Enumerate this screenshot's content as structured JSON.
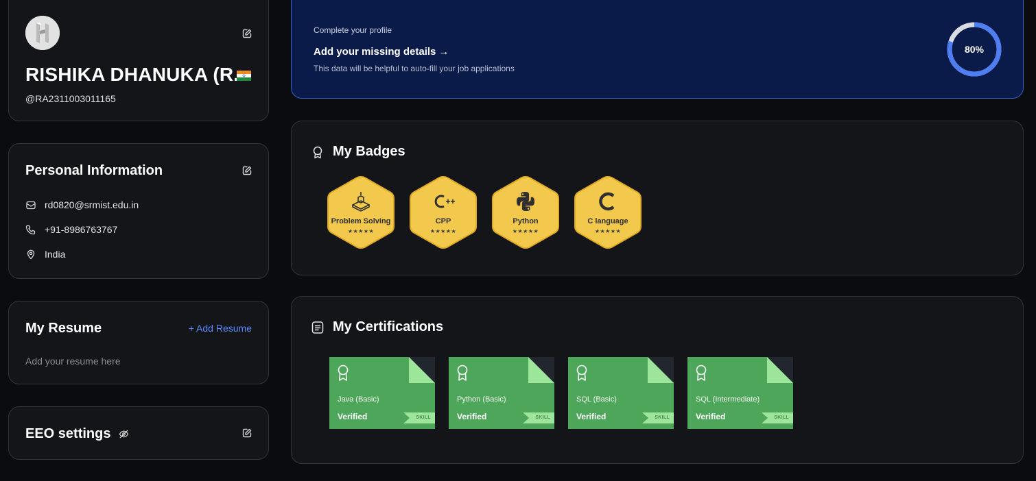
{
  "profile": {
    "name": "RISHIKA DHANUKA (R...",
    "handle": "@RA2311003011165",
    "country_flag": "india-flag-icon",
    "avatar_initial": "H"
  },
  "personal_info": {
    "title": "Personal Information",
    "email": "rd0820@srmist.edu.in",
    "phone": "+91-8986763767",
    "location": "India"
  },
  "resume": {
    "title": "My Resume",
    "add_label": "+ Add Resume",
    "hint": "Add your resume here"
  },
  "eeo": {
    "title": "EEO settings"
  },
  "banner": {
    "kicker": "Complete your profile",
    "title": "Add your missing details →",
    "description": "This data will be helpful to auto-fill your job applications",
    "progress_label": "80%",
    "progress_value": 0.8
  },
  "badges": {
    "title": "My Badges",
    "items": [
      {
        "name": "Problem Solving",
        "stars": "★★★★★",
        "icon": "problem-solving-icon"
      },
      {
        "name": "CPP",
        "stars": "★★★★★",
        "icon": "cpp-icon"
      },
      {
        "name": "Python",
        "stars": "★★★★★",
        "icon": "python-icon"
      },
      {
        "name": "C language",
        "stars": "★★★★★",
        "icon": "c-language-icon"
      }
    ]
  },
  "certifications": {
    "title": "My Certifications",
    "items": [
      {
        "name": "Java (Basic)",
        "status": "Verified",
        "tag": "SKILL"
      },
      {
        "name": "Python (Basic)",
        "status": "Verified",
        "tag": "SKILL"
      },
      {
        "name": "SQL (Basic)",
        "status": "Verified",
        "tag": "SKILL"
      },
      {
        "name": "SQL (Intermediate)",
        "status": "Verified",
        "tag": "SKILL"
      }
    ]
  },
  "colors": {
    "background": "#0b0c10",
    "card": "#141519",
    "banner": "#0a1b4a",
    "accent": "#5b8cff",
    "badge_gold": "#f2c94c",
    "cert_green": "#4ea65a"
  }
}
